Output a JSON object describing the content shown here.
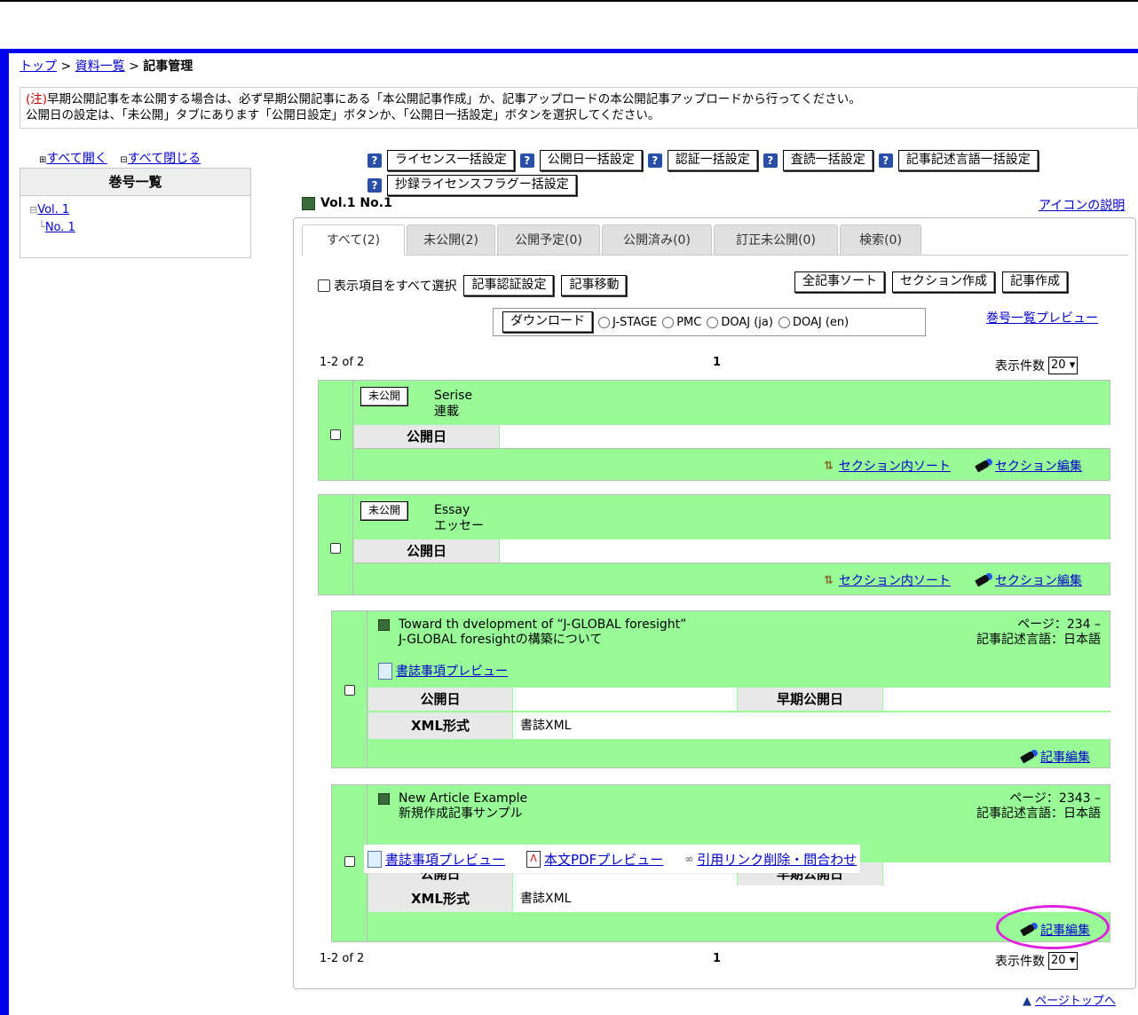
{
  "breadcrumb": {
    "top": "トップ",
    "sep1": " > ",
    "list": "資料一覧",
    "sep2": " > ",
    "current": "記事管理"
  },
  "notice": {
    "prefix": "(注)",
    "line1": "早期公開記事を本公開する場合は、必ず早期公開記事にある「本公開記事作成」か、記事アップロードの本公開記事アップロードから行ってください。",
    "line2": "公開日の設定は、「未公開」タブにあります「公開日設定」ボタンか、「公開日一括設定」ボタンを選択してください。"
  },
  "sidebar": {
    "expand_all": "すべて開く",
    "collapse_all": "すべて閉じる",
    "title": "巻号一覧",
    "tree": {
      "vol": "Vol. 1",
      "no": "No. 1"
    }
  },
  "toolbar": {
    "help": "?",
    "buttons": [
      "ライセンス一括設定",
      "公開日一括設定",
      "認証一括設定",
      "査読一括設定",
      "記事記述言語一括設定",
      "抄録ライセンスフラグー括設定"
    ]
  },
  "volume": {
    "title": "Vol.1 No.1",
    "icon_legend": "アイコンの説明"
  },
  "tabs": [
    "すべて(2)",
    "未公開(2)",
    "公開予定(0)",
    "公開済み(0)",
    "訂正未公開(0)",
    "検索(0)"
  ],
  "actions": {
    "select_all": "表示項目をすべて選択",
    "auth_button": "記事認証設定",
    "move_button": "記事移動",
    "sort_all": "全記事ソート",
    "create_section": "セクション作成",
    "create_article": "記事作成",
    "download": "ダウンロード",
    "formats": [
      "J-STAGE",
      "PMC",
      "DOAJ (ja)",
      "DOAJ (en)"
    ],
    "issue_preview": "巻号一覧プレビュー"
  },
  "pagination": {
    "range": "1-2 of 2",
    "page": "1",
    "per_page_label": "表示件数",
    "per_page_value": "20"
  },
  "sections": [
    {
      "status": "未公開",
      "name_en": "Serise",
      "name_ja": "連載",
      "pubdate_label": "公開日",
      "sort_link": "セクション内ソート",
      "edit_link": "セクション編集"
    },
    {
      "status": "未公開",
      "name_en": "Essay",
      "name_ja": "エッセー",
      "pubdate_label": "公開日",
      "sort_link": "セクション内ソート",
      "edit_link": "セクション編集"
    }
  ],
  "articles": [
    {
      "title_en": "Toward th dvelopment of “J-GLOBAL foresight”",
      "title_ja": "J-GLOBAL foresightの構築について",
      "page": "ページ：234 –",
      "language": "記事記述言語：日本語",
      "biblio_preview": "書誌事項プレビュー",
      "pubdate_label": "公開日",
      "early_label": "早期公開日",
      "xml_label": "XML形式",
      "xml_value": "書誌XML",
      "edit_link": "記事編集"
    },
    {
      "title_en": "New Article Example",
      "title_ja": "新規作成記事サンプル",
      "page": "ページ：2343 –",
      "language": "記事記述言語：日本語",
      "biblio_preview": "書誌事項プレビュー",
      "pdf_preview": "本文PDFプレビュー",
      "citation": "引用リンク削除・問合わせ",
      "pubdate_label": "公開日",
      "early_label": "早期公開日",
      "xml_label": "XML形式",
      "xml_value": "書誌XML",
      "edit_link": "記事編集"
    }
  ],
  "page_top": "ページトップへ",
  "colors": {
    "frame": "#0000ee",
    "card": "#98fb98",
    "highlight": "#e020e0",
    "link": "#0000cc"
  }
}
